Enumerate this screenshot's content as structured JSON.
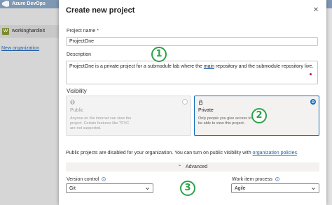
{
  "app": {
    "title": "Azure DevOps",
    "org": {
      "avatar_letter": "W",
      "name": "workinghardinit"
    },
    "new_org_label": "New organization"
  },
  "modal": {
    "title": "Create new project",
    "close_icon": "close-icon",
    "project_name": {
      "label": "Project name",
      "required_marker": "*",
      "value": "ProjectOne"
    },
    "description": {
      "label": "Description",
      "value_before": "ProjectOne is a private project for a submodule lab where the ",
      "value_underlined": "main",
      "value_after": " repository and the submodule repository live."
    },
    "visibility": {
      "label": "Visibility",
      "options": [
        {
          "title": "Public",
          "description": "Anyone on the internet can view the project. Certain features like TFVC are not supported.",
          "icon": "globe-icon",
          "selected": false,
          "disabled": true
        },
        {
          "title": "Private",
          "description": "Only people you give access to will be able to view this project.",
          "icon": "lock-icon",
          "selected": true,
          "disabled": false
        }
      ]
    },
    "public_notice": {
      "text": "Public projects are disabled for your organization. You can turn on public visibility with ",
      "link": "organization policies",
      "suffix": "."
    },
    "advanced": {
      "label": "Advanced",
      "icon": "chevron-up-icon"
    },
    "version_control": {
      "label": "Version control",
      "value": "Git"
    },
    "work_item_process": {
      "label": "Work item process",
      "value": "Agile"
    }
  },
  "annotations": [
    "1",
    "2",
    "3"
  ],
  "colors": {
    "accent": "#0f6cbd",
    "annotation": "#2aa34a",
    "link": "#1f5fa6"
  }
}
